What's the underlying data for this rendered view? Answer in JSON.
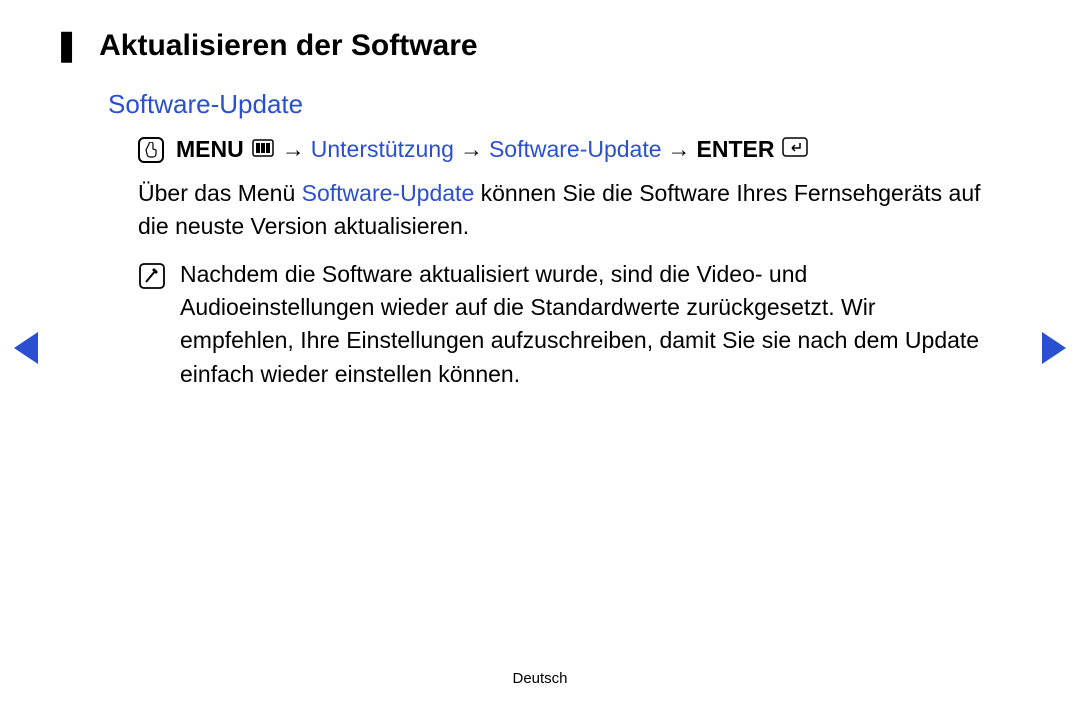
{
  "title": {
    "bullet": "❚",
    "text": "Aktualisieren der Software"
  },
  "subtitle": "Software-Update",
  "path": {
    "menu": "MENU",
    "arrow": "→",
    "step1": "Unterstützung",
    "step2": "Software-Update",
    "enter": "ENTER"
  },
  "body": {
    "pre": "Über das Menü ",
    "highlight": "Software-Update",
    "post": " können Sie die Software Ihres Fernsehgeräts auf die neuste Version aktualisieren."
  },
  "note": "Nachdem die Software aktualisiert wurde, sind die Video- und Audioeinstellungen wieder auf die Standardwerte zurückgesetzt. Wir empfehlen, Ihre Einstellungen aufzuschreiben, damit Sie sie nach dem Update einfach wieder einstellen können.",
  "footer": "Deutsch",
  "icons": {
    "touch": "touch-icon",
    "menu": "menu-icon",
    "enter": "enter-icon",
    "note": "note-icon",
    "prev": "chevron-left-icon",
    "next": "chevron-right-icon"
  }
}
